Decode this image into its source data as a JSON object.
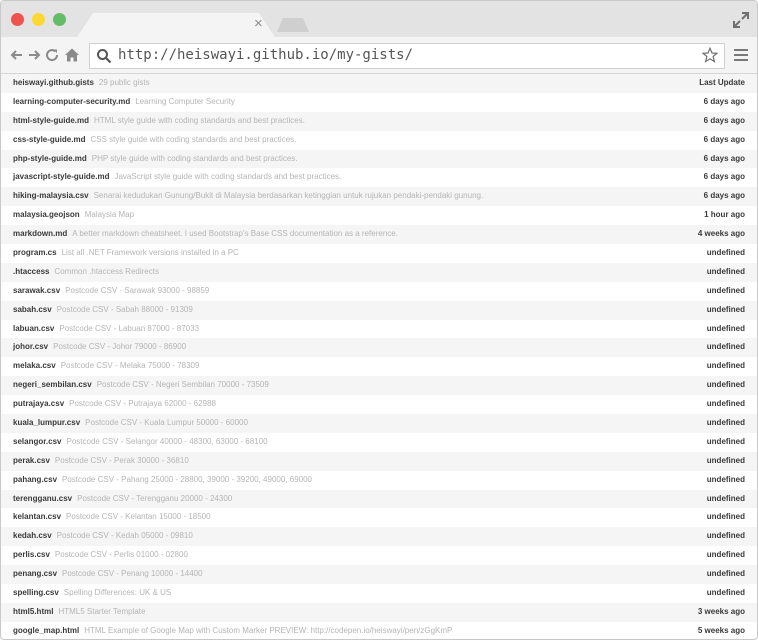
{
  "browser": {
    "url": "http://heiswayi.github.io/my-gists/",
    "tab_close": "×"
  },
  "header": {
    "site": "heiswayi.github.gists",
    "count": "29 public gists",
    "last_update_label": "Last Update"
  },
  "gists": [
    {
      "name": "learning-computer-security.md",
      "description": "Learning Computer Security",
      "updated": "6 days ago"
    },
    {
      "name": "html-style-guide.md",
      "description": "HTML style guide with coding standards and best practices.",
      "updated": "6 days ago"
    },
    {
      "name": "css-style-guide.md",
      "description": "CSS style guide with coding standards and best practices.",
      "updated": "6 days ago"
    },
    {
      "name": "php-style-guide.md",
      "description": "PHP style guide with coding standards and best practices.",
      "updated": "6 days ago"
    },
    {
      "name": "javascript-style-guide.md",
      "description": "JavaScript style guide with coding standards and best practices.",
      "updated": "6 days ago"
    },
    {
      "name": "hiking-malaysia.csv",
      "description": "Senarai kedudukan Gunung/Bukit di Malaysia berdasarkan ketinggian untuk rujukan pendaki-pendaki gunung.",
      "updated": "6 days ago"
    },
    {
      "name": "malaysia.geojson",
      "description": "Malaysia Map",
      "updated": "1 hour ago"
    },
    {
      "name": "markdown.md",
      "description": "A better markdown cheatsheet. I used Bootstrap's Base CSS documentation as a reference.",
      "updated": "4 weeks ago"
    },
    {
      "name": "program.cs",
      "description": "List all .NET Framework versions installed in a PC",
      "updated": "undefined"
    },
    {
      "name": ".htaccess",
      "description": "Common .htaccess Redirects",
      "updated": "undefined"
    },
    {
      "name": "sarawak.csv",
      "description": "Postcode CSV - Sarawak 93000 - 98859",
      "updated": "undefined"
    },
    {
      "name": "sabah.csv",
      "description": "Postcode CSV - Sabah 88000 - 91309",
      "updated": "undefined"
    },
    {
      "name": "labuan.csv",
      "description": "Postcode CSV - Labuan 87000 - 87033",
      "updated": "undefined"
    },
    {
      "name": "johor.csv",
      "description": "Postcode CSV - Johor 79000 - 86900",
      "updated": "undefined"
    },
    {
      "name": "melaka.csv",
      "description": "Postcode CSV - Melaka 75000 - 78309",
      "updated": "undefined"
    },
    {
      "name": "negeri_sembilan.csv",
      "description": "Postcode CSV - Negeri Sembilan 70000 - 73509",
      "updated": "undefined"
    },
    {
      "name": "putrajaya.csv",
      "description": "Postcode CSV - Putrajaya 62000 - 62988",
      "updated": "undefined"
    },
    {
      "name": "kuala_lumpur.csv",
      "description": "Postcode CSV - Kuala Lumpur 50000 - 60000",
      "updated": "undefined"
    },
    {
      "name": "selangor.csv",
      "description": "Postcode CSV - Selangor 40000 - 48300, 63000 - 68100",
      "updated": "undefined"
    },
    {
      "name": "perak.csv",
      "description": "Postcode CSV - Perak 30000 - 36810",
      "updated": "undefined"
    },
    {
      "name": "pahang.csv",
      "description": "Postcode CSV - Pahang 25000 - 28800, 39000 - 39200, 49000, 69000",
      "updated": "undefined"
    },
    {
      "name": "terengganu.csv",
      "description": "Postcode CSV - Terengganu 20000 - 24300",
      "updated": "undefined"
    },
    {
      "name": "kelantan.csv",
      "description": "Postcode CSV - Kelantan 15000 - 18500",
      "updated": "undefined"
    },
    {
      "name": "kedah.csv",
      "description": "Postcode CSV - Kedah 05000 - 09810",
      "updated": "undefined"
    },
    {
      "name": "perlis.csv",
      "description": "Postcode CSV - Perlis 01000 - 02800",
      "updated": "undefined"
    },
    {
      "name": "penang.csv",
      "description": "Postcode CSV - Penang 10000 - 14400",
      "updated": "undefined"
    },
    {
      "name": "spelling.csv",
      "description": "Spelling Differences: UK & US",
      "updated": "undefined"
    },
    {
      "name": "html5.html",
      "description": "HTML5 Starter Template",
      "updated": "3 weeks ago"
    },
    {
      "name": "google_map.html",
      "description": "HTML Example of Google Map with Custom Marker PREVIEW: http://codepen.io/heiswayi/pen/zGgKmP",
      "updated": "5 weeks ago"
    }
  ]
}
